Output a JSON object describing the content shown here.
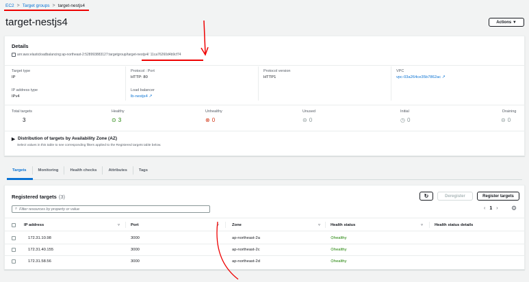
{
  "breadcrumb": {
    "items": [
      "EC2",
      "Target groups",
      "target-nestjs4"
    ],
    "sep": ">"
  },
  "page_title": "target-nestjs4",
  "actions_button": "Actions ▼",
  "details": {
    "title": "Details",
    "arn_prefix": "arn:aws:elasticloadbalancing:ap-northeast-2:528993883127:targetgroup/target-nestjs4/",
    "arn_suffix": "11ca76260d4b9cf74",
    "target_type_label": "Target type",
    "target_type": "IP",
    "protocol_port_label": "Protocol : Port",
    "protocol_port": "HTTP: 80",
    "protocol_version_label": "Protocol version",
    "protocol_version": "HTTP1",
    "vpc_label": "VPC",
    "vpc": "vpc-03a264ce35b7862ac",
    "ip_type_label": "IP address type",
    "ip_type": "IPv4",
    "lb_label": "Load balancer",
    "lb": "lb-nestjs4",
    "stats": {
      "total_label": "Total targets",
      "total": "3",
      "healthy_label": "Healthy",
      "healthy": "3",
      "unhealthy_label": "Unhealthy",
      "unhealthy": "0",
      "unused_label": "Unused",
      "unused": "0",
      "initial_label": "Initial",
      "initial": "0",
      "draining_label": "Draining",
      "draining": "0"
    },
    "distribution_title": "Distribution of targets by Availability Zone (AZ)",
    "distribution_desc": "Select values in this table to see corresponding filters applied to the Registered targets table below."
  },
  "tabs": [
    "Targets",
    "Monitoring",
    "Health checks",
    "Attributes",
    "Tags"
  ],
  "registered": {
    "title": "Registered targets",
    "count": "(3)",
    "deregister": "Deregister",
    "register": "Register targets",
    "search_placeholder": "Filter resources by property or value",
    "page": "1",
    "columns": [
      "IP address",
      "Port",
      "Zone",
      "Health status",
      "Health status details"
    ],
    "rows": [
      {
        "ip": "172.31.10.98",
        "port": "3000",
        "zone": "ap-northeast-2a",
        "health": "healthy",
        "details": ""
      },
      {
        "ip": "172.31.40.155",
        "port": "3000",
        "zone": "ap-northeast-2c",
        "health": "healthy",
        "details": ""
      },
      {
        "ip": "172.31.58.56",
        "port": "3000",
        "zone": "ap-northeast-2d",
        "health": "healthy",
        "details": ""
      }
    ]
  },
  "colors": {
    "link": "#0972d3",
    "healthy": "#1d8102",
    "unhealthy": "#d13212",
    "annotation": "#e00000"
  }
}
